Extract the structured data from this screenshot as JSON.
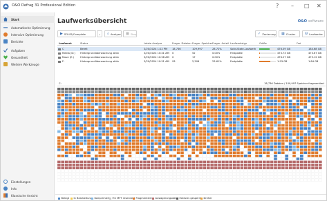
{
  "window": {
    "title": "O&O Defrag 31 Professional Edition",
    "controls": [
      "?",
      "–",
      "□",
      "✕"
    ]
  },
  "sidebar": {
    "top": [
      {
        "label": "Start",
        "icon": "home-icon",
        "active": true
      },
      {
        "label": "Automatische Optimierung",
        "icon": "dash-icon"
      },
      {
        "label": "Intensive Optimierung",
        "icon": "target-icon"
      },
      {
        "label": "Berichte",
        "icon": "report-icon"
      },
      {
        "label": "Aufgaben",
        "icon": "tasks-icon"
      },
      {
        "label": "Gesundheit",
        "icon": "heart-icon"
      },
      {
        "label": "Weitere Werkzeuge",
        "icon": "tools-icon"
      }
    ],
    "bottom": [
      {
        "label": "Einstellungen",
        "icon": "gear-icon"
      },
      {
        "label": "Info",
        "icon": "info-icon"
      },
      {
        "label": "Klassische Ansicht",
        "icon": "grid-icon"
      }
    ]
  },
  "header": {
    "title": "Laufwerksübersicht",
    "brand_prefix": "O&O",
    "brand_suffix": "software"
  },
  "toolbar": {
    "method": "SOLID/Complete",
    "analyze": "Analyse",
    "stop": "Stop",
    "zoning": "Zonierung",
    "clusters": "Cluster",
    "drives": "Laufwerke"
  },
  "table": {
    "headers": [
      "Laufwerk",
      "Status",
      "Letzte Analyse",
      "Fragm. Dateien",
      "Fragm. Speicher",
      "Fragm. Anteil",
      "Laufwerkstyp",
      "Größe",
      "Frei"
    ],
    "rows": [
      {
        "drive": "C",
        "status": "Bereit",
        "last": "3/20/2024 1:22 PM",
        "files": "18,736",
        "space": "109,997",
        "pct": "28.72%",
        "type": "Solid-State-Laufwerk",
        "size": "476.09 GB",
        "free": "184.68 GB",
        "fill": 0.61,
        "color": "#4bb04b",
        "selected": true
      },
      {
        "drive": "Media (D:)",
        "status": "Hintergrundüberwachung aktiv",
        "last": "3/20/2024 10:41 AM",
        "files": "0",
        "space": "52",
        "pct": "0.00%",
        "type": "Festplatte",
        "size": "473.73 GB",
        "free": "473.67 GB",
        "fill": 0.01,
        "color": "#e07b2c",
        "selected": false
      },
      {
        "drive": "Move (E:)",
        "status": "Hintergrundüberwachung aktiv",
        "last": "3/20/2024 10:58 AM",
        "files": "0",
        "space": "17",
        "pct": "0.00%",
        "type": "Festplatte",
        "size": "476.27 GB",
        "free": "475.12 GB",
        "fill": 0.01,
        "color": "#e07b2c",
        "selected": false
      },
      {
        "drive": "F:",
        "status": "Hintergrundüberwachung aktiv",
        "last": "3/20/2024 10:51 AM",
        "files": "93",
        "space": "2,206",
        "pct": "23.61%",
        "type": "Festplatte",
        "size": "1.93 GB",
        "free": "1.84 GB",
        "fill": 0.65,
        "color": "#e07b2c",
        "selected": false
      }
    ]
  },
  "map": {
    "drive": "C:",
    "summary": "18,736 Dateien / 109,997 Speicher fragmentiert"
  },
  "legend": [
    {
      "label": "Belegt",
      "color": "#4a84c4"
    },
    {
      "label": "In Bearbeitung",
      "color": "#f2c94c"
    },
    {
      "label": "Komprimiert",
      "color": "#7fb7e6"
    },
    {
      "label": "Für MFT reserviert",
      "color": "#c8c8c8"
    },
    {
      "label": "Fragmentiert",
      "color": "#e07b2c"
    },
    {
      "label": "Auslagerungsdatei",
      "color": "#b56b6b"
    },
    {
      "label": "Exklusiv gesperrt",
      "color": "#555555"
    },
    {
      "label": "Dreher",
      "color": "#e9a23b"
    }
  ]
}
